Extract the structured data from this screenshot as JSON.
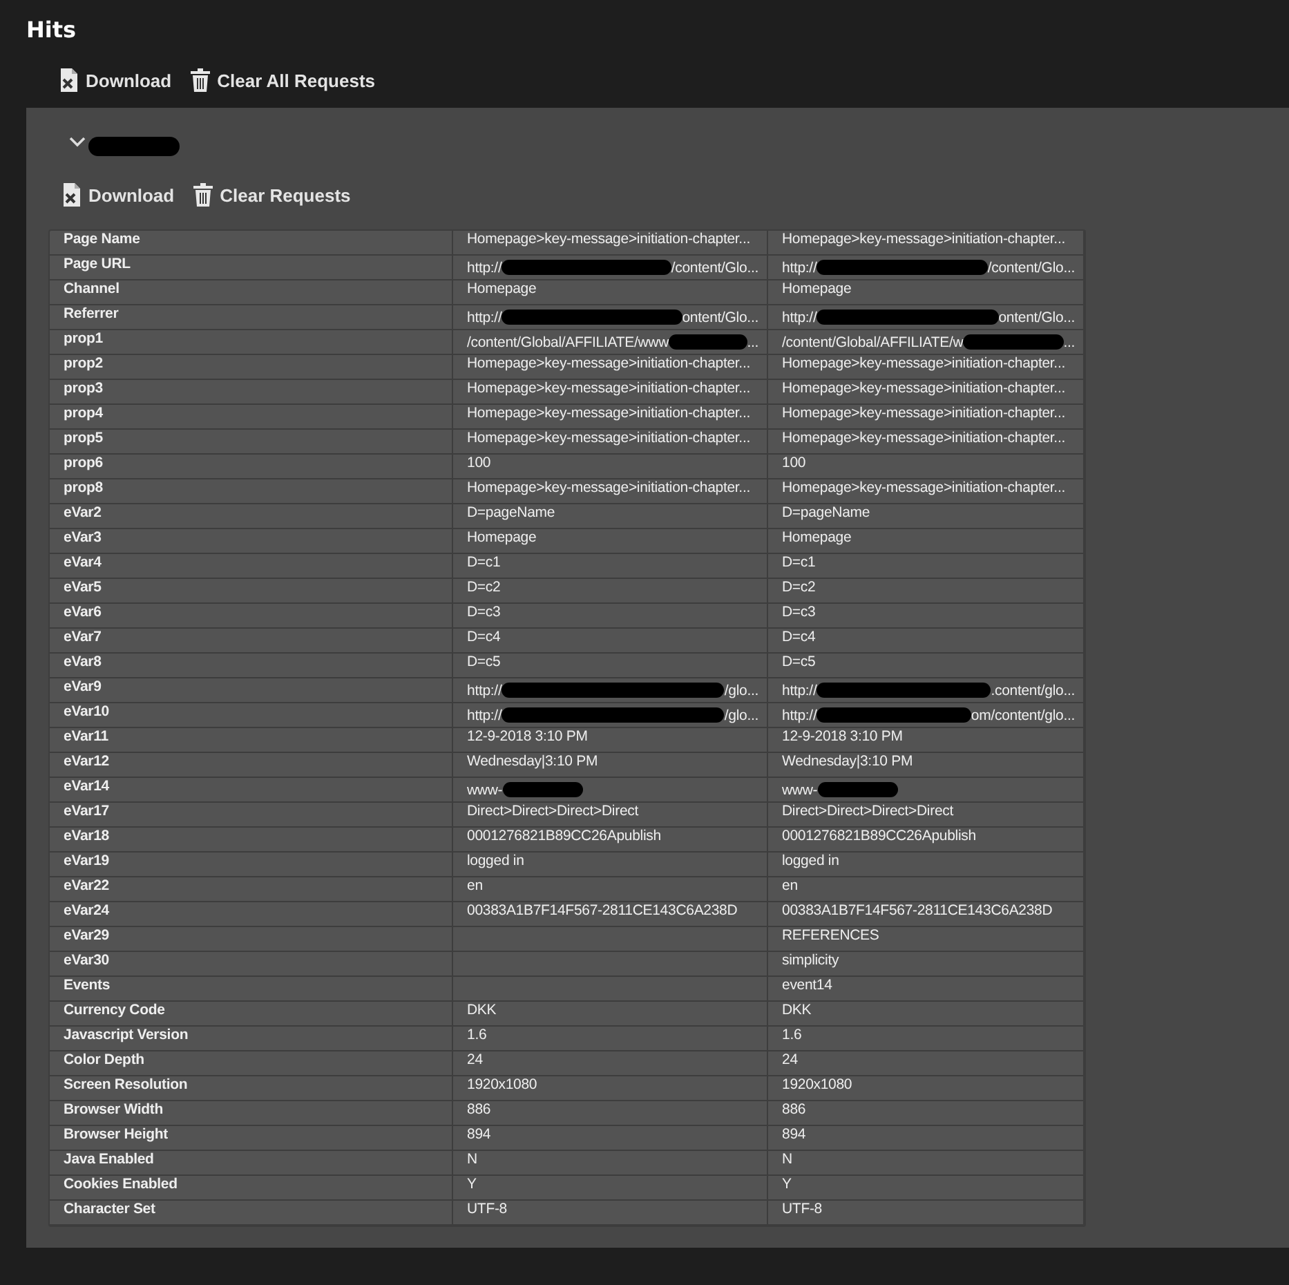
{
  "title": "Hits",
  "toolbar": [
    {
      "kind": "download",
      "label": "Download"
    },
    {
      "kind": "clear",
      "label": "Clear All Requests"
    }
  ],
  "group": {
    "expanded": true,
    "name_redacted": true,
    "toolbar": [
      {
        "kind": "download",
        "label": "Download"
      },
      {
        "kind": "clear",
        "label": "Clear Requests"
      }
    ],
    "rows": [
      {
        "label": "Page Name",
        "values": [
          "Homepage>key-message>initiation-chapter...",
          "Homepage>key-message>initiation-chapter..."
        ]
      },
      {
        "label": "Page URL",
        "values": [
          {
            "kind": "redacted",
            "before": "http://",
            "after": "/content/Glo..."
          },
          {
            "kind": "redacted",
            "before": "http://",
            "after": "/content/Glo..."
          }
        ]
      },
      {
        "label": "Channel",
        "values": [
          "Homepage",
          "Homepage"
        ]
      },
      {
        "label": "Referrer",
        "values": [
          {
            "kind": "redacted",
            "before": "http://",
            "after": "ontent/Glo..."
          },
          {
            "kind": "redacted",
            "before": "http://",
            "after": "ontent/Glo..."
          }
        ]
      },
      {
        "label": "prop1",
        "values": [
          {
            "kind": "redacted",
            "before": "/content/Global/AFFILIATE/www",
            "after": "..."
          },
          {
            "kind": "redacted",
            "before": "/content/Global/AFFILIATE/w",
            "after": "..."
          }
        ]
      },
      {
        "label": "prop2",
        "values": [
          "Homepage>key-message>initiation-chapter...",
          "Homepage>key-message>initiation-chapter..."
        ]
      },
      {
        "label": "prop3",
        "values": [
          "Homepage>key-message>initiation-chapter...",
          "Homepage>key-message>initiation-chapter..."
        ]
      },
      {
        "label": "prop4",
        "values": [
          "Homepage>key-message>initiation-chapter...",
          "Homepage>key-message>initiation-chapter..."
        ]
      },
      {
        "label": "prop5",
        "values": [
          "Homepage>key-message>initiation-chapter...",
          "Homepage>key-message>initiation-chapter..."
        ]
      },
      {
        "label": "prop6",
        "values": [
          "100",
          "100"
        ]
      },
      {
        "label": "prop8",
        "values": [
          "Homepage>key-message>initiation-chapter...",
          "Homepage>key-message>initiation-chapter..."
        ]
      },
      {
        "label": "eVar2",
        "values": [
          "D=pageName",
          "D=pageName"
        ]
      },
      {
        "label": "eVar3",
        "values": [
          "Homepage",
          "Homepage"
        ]
      },
      {
        "label": "eVar4",
        "values": [
          "D=c1",
          "D=c1"
        ]
      },
      {
        "label": "eVar5",
        "values": [
          "D=c2",
          "D=c2"
        ]
      },
      {
        "label": "eVar6",
        "values": [
          "D=c3",
          "D=c3"
        ]
      },
      {
        "label": "eVar7",
        "values": [
          "D=c4",
          "D=c4"
        ]
      },
      {
        "label": "eVar8",
        "values": [
          "D=c5",
          "D=c5"
        ]
      },
      {
        "label": "eVar9",
        "values": [
          {
            "kind": "redacted",
            "before": "http://",
            "after": "/glo..."
          },
          {
            "kind": "redacted",
            "before": "http://",
            "after": ".content/glo..."
          }
        ]
      },
      {
        "label": "eVar10",
        "values": [
          {
            "kind": "redacted",
            "before": "http://",
            "after": "/glo..."
          },
          {
            "kind": "redacted",
            "before": "http://",
            "after": "om/content/glo..."
          }
        ]
      },
      {
        "label": "eVar11",
        "values": [
          "12-9-2018 3:10 PM",
          "12-9-2018 3:10 PM"
        ]
      },
      {
        "label": "eVar12",
        "values": [
          "Wednesday|3:10 PM",
          "Wednesday|3:10 PM"
        ]
      },
      {
        "label": "eVar14",
        "values": [
          {
            "kind": "redacted",
            "before": "www-"
          },
          {
            "kind": "redacted",
            "before": "www-"
          }
        ]
      },
      {
        "label": "eVar17",
        "values": [
          "Direct>Direct>Direct>Direct",
          "Direct>Direct>Direct>Direct"
        ]
      },
      {
        "label": "eVar18",
        "values": [
          "0001276821B89CC26Apublish",
          "0001276821B89CC26Apublish"
        ]
      },
      {
        "label": "eVar19",
        "values": [
          "logged in",
          "logged in"
        ]
      },
      {
        "label": "eVar22",
        "values": [
          "en",
          "en"
        ]
      },
      {
        "label": "eVar24",
        "values": [
          "00383A1B7F14F567-2811CE143C6A238D",
          "00383A1B7F14F567-2811CE143C6A238D"
        ]
      },
      {
        "label": "eVar29",
        "values": [
          {
            "kind": "empty"
          },
          "REFERENCES"
        ]
      },
      {
        "label": "eVar30",
        "values": [
          {
            "kind": "empty"
          },
          "simplicity"
        ]
      },
      {
        "label": "Events",
        "values": [
          {
            "kind": "empty"
          },
          "event14"
        ]
      },
      {
        "label": "Currency Code",
        "values": [
          "DKK",
          "DKK"
        ]
      },
      {
        "label": "Javascript Version",
        "values": [
          "1.6",
          "1.6"
        ]
      },
      {
        "label": "Color Depth",
        "values": [
          "24",
          "24"
        ]
      },
      {
        "label": "Screen Resolution",
        "values": [
          "1920x1080",
          "1920x1080"
        ]
      },
      {
        "label": "Browser Width",
        "values": [
          "886",
          "886"
        ]
      },
      {
        "label": "Browser Height",
        "values": [
          "894",
          "894"
        ]
      },
      {
        "label": "Java Enabled",
        "values": [
          "N",
          "N"
        ]
      },
      {
        "label": "Cookies Enabled",
        "values": [
          "Y",
          "Y"
        ]
      },
      {
        "label": "Character Set",
        "values": [
          "UTF-8",
          "UTF-8"
        ]
      }
    ]
  }
}
